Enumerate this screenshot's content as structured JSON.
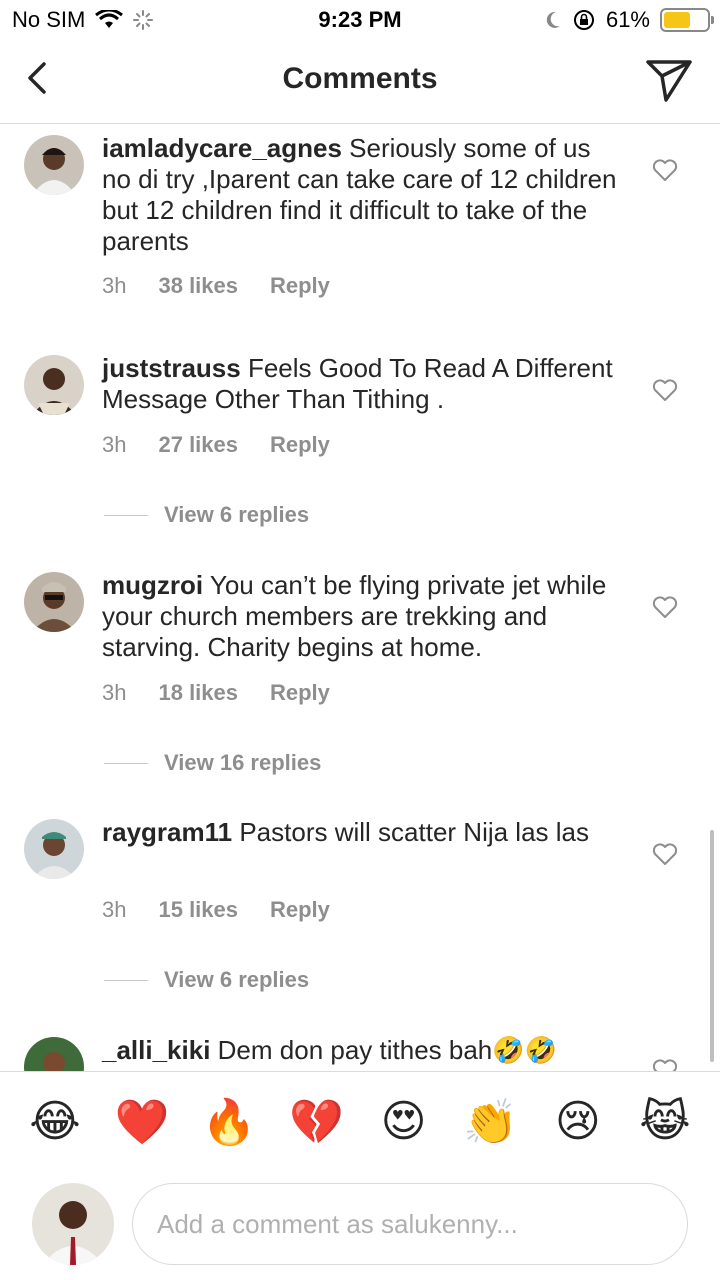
{
  "status_bar": {
    "carrier": "No SIM",
    "time": "9:23 PM",
    "battery": "61%",
    "battery_level": 0.61,
    "battery_color": "#f5c518"
  },
  "header": {
    "title": "Comments",
    "back_icon": "chevron-left-icon",
    "send_icon": "paper-plane-icon"
  },
  "comments": [
    {
      "username": "iamladycare_agnes",
      "text": "Seriously some of us no di try ,Iparent can take care of 12 children but 12 children find it difficult to take of the parents",
      "time": "3h",
      "likes": "38 likes",
      "reply": "Reply"
    },
    {
      "username": "juststrauss",
      "text": "Feels Good To Read A Different Message Other Than Tithing .",
      "time": "3h",
      "likes": "27 likes",
      "reply": "Reply",
      "view_replies": "View 6 replies"
    },
    {
      "username": "mugzroi",
      "text": "You can’t be flying private jet while your church members are trekking and starving. Charity begins at home.",
      "time": "3h",
      "likes": "18 likes",
      "reply": "Reply",
      "view_replies": "View 16 replies"
    },
    {
      "username": "raygram11",
      "text": "Pastors will scatter Nija las las",
      "time": "3h",
      "likes": "15 likes",
      "reply": "Reply",
      "view_replies": "View 6 replies"
    },
    {
      "username": "_alli_kiki",
      "text": "Dem don pay tithes bah🤣🤣"
    }
  ],
  "emoji_bar": [
    "😂",
    "❤️",
    "🔥",
    "💔",
    "😍",
    "👏",
    "😢",
    "😹"
  ],
  "input": {
    "placeholder": "Add a comment as salukenny..."
  }
}
